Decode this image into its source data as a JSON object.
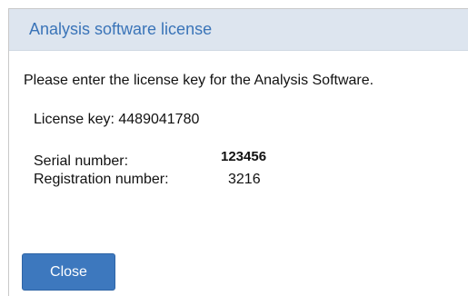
{
  "dialog": {
    "title": "Analysis software license",
    "instruction": "Please enter the license key for the Analysis Software.",
    "license_key_text": "License key: 4489041780",
    "serial_label": "Serial number:",
    "serial_value": "123456",
    "registration_label": "Registration number:",
    "registration_value": "3216",
    "close_label": "Close"
  },
  "colors": {
    "title_text": "#3a74b8",
    "titlebar_bg": "#dde5ef",
    "button_bg": "#3d78be"
  }
}
